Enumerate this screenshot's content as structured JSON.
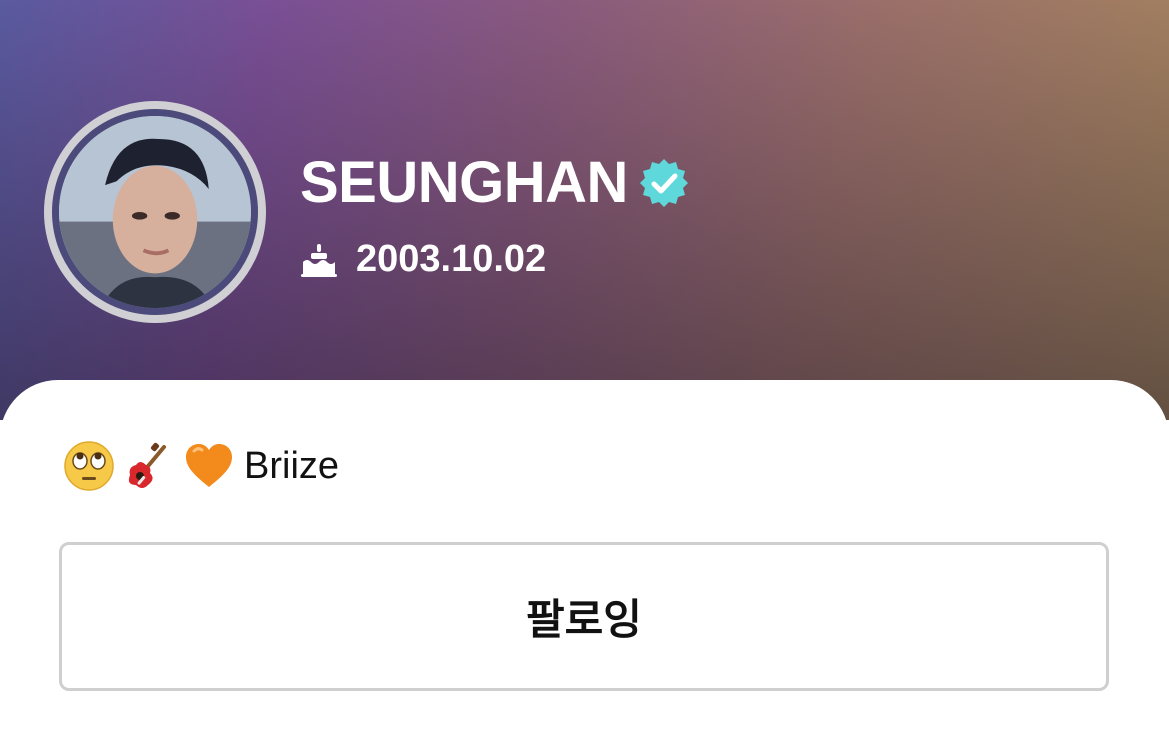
{
  "profile": {
    "name": "SEUNGHAN",
    "verified_icon": "verified-badge-icon",
    "birthday_icon": "cake-icon",
    "birthday": "2003.10.02",
    "bio_emojis": [
      "face-with-rolling-eyes-icon",
      "guitar-icon",
      "orange-heart-icon"
    ],
    "bio_text": "Briize"
  },
  "actions": {
    "follow_label": "팔로잉"
  },
  "colors": {
    "verified_badge": "#5fd8dc",
    "button_border": "#cfcfcf",
    "avatar_ring": "#cfcfd4",
    "text_dark": "#111111"
  }
}
